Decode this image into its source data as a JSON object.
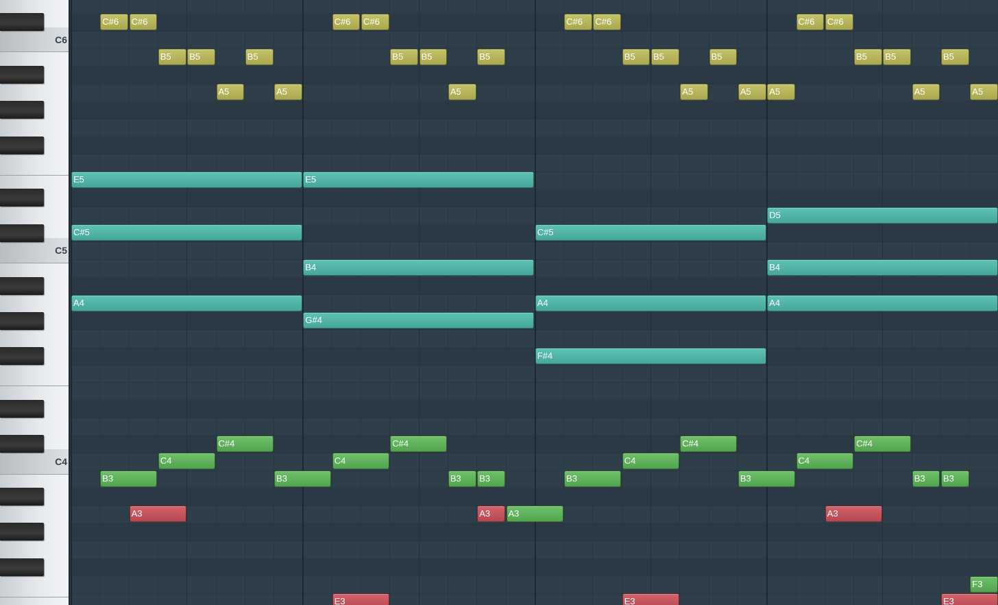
{
  "app": {
    "view": "piano-roll"
  },
  "keyboard": {
    "octave_labels": [
      "C6",
      "C5",
      "C4"
    ]
  },
  "note_colors": {
    "yellow": "#b9b85c",
    "teal": "#52b6a8",
    "green": "#62b35e",
    "red": "#c4545e"
  },
  "notes": [
    {
      "label": "C#6",
      "color": "yellow",
      "start": 1,
      "len": 1,
      "pitch": 85
    },
    {
      "label": "C#6",
      "color": "yellow",
      "start": 2,
      "len": 1,
      "pitch": 85
    },
    {
      "label": "C#6",
      "color": "yellow",
      "start": 9,
      "len": 1,
      "pitch": 85
    },
    {
      "label": "C#6",
      "color": "yellow",
      "start": 10,
      "len": 1,
      "pitch": 85
    },
    {
      "label": "C#6",
      "color": "yellow",
      "start": 17,
      "len": 1,
      "pitch": 85
    },
    {
      "label": "C#6",
      "color": "yellow",
      "start": 18,
      "len": 1,
      "pitch": 85
    },
    {
      "label": "C#6",
      "color": "yellow",
      "start": 25,
      "len": 1,
      "pitch": 85
    },
    {
      "label": "C#6",
      "color": "yellow",
      "start": 26,
      "len": 1,
      "pitch": 85
    },
    {
      "label": "B5",
      "color": "yellow",
      "start": 3,
      "len": 1,
      "pitch": 83
    },
    {
      "label": "B5",
      "color": "yellow",
      "start": 4,
      "len": 1,
      "pitch": 83
    },
    {
      "label": "B5",
      "color": "yellow",
      "start": 6,
      "len": 1,
      "pitch": 83
    },
    {
      "label": "B5",
      "color": "yellow",
      "start": 11,
      "len": 1,
      "pitch": 83
    },
    {
      "label": "B5",
      "color": "yellow",
      "start": 12,
      "len": 1,
      "pitch": 83
    },
    {
      "label": "B5",
      "color": "yellow",
      "start": 14,
      "len": 1,
      "pitch": 83
    },
    {
      "label": "B5",
      "color": "yellow",
      "start": 19,
      "len": 1,
      "pitch": 83
    },
    {
      "label": "B5",
      "color": "yellow",
      "start": 20,
      "len": 1,
      "pitch": 83
    },
    {
      "label": "B5",
      "color": "yellow",
      "start": 22,
      "len": 1,
      "pitch": 83
    },
    {
      "label": "B5",
      "color": "yellow",
      "start": 27,
      "len": 1,
      "pitch": 83
    },
    {
      "label": "B5",
      "color": "yellow",
      "start": 28,
      "len": 1,
      "pitch": 83
    },
    {
      "label": "B5",
      "color": "yellow",
      "start": 30,
      "len": 1,
      "pitch": 83
    },
    {
      "label": "A5",
      "color": "yellow",
      "start": 5,
      "len": 1,
      "pitch": 81
    },
    {
      "label": "A5",
      "color": "yellow",
      "start": 7,
      "len": 1,
      "pitch": 81
    },
    {
      "label": "A5",
      "color": "yellow",
      "start": 13,
      "len": 1,
      "pitch": 81
    },
    {
      "label": "A5",
      "color": "yellow",
      "start": 21,
      "len": 1,
      "pitch": 81
    },
    {
      "label": "A5",
      "color": "yellow",
      "start": 23,
      "len": 1,
      "pitch": 81
    },
    {
      "label": "A5",
      "color": "yellow",
      "start": 24,
      "len": 1,
      "pitch": 81
    },
    {
      "label": "A5",
      "color": "yellow",
      "start": 29,
      "len": 1,
      "pitch": 81
    },
    {
      "label": "A5",
      "color": "yellow",
      "start": 31,
      "len": 1,
      "pitch": 81
    },
    {
      "label": "E5",
      "color": "teal",
      "start": 0,
      "len": 8,
      "pitch": 76
    },
    {
      "label": "E5",
      "color": "teal",
      "start": 8,
      "len": 8,
      "pitch": 76
    },
    {
      "label": "D5",
      "color": "teal",
      "start": 24,
      "len": 8,
      "pitch": 74
    },
    {
      "label": "C#5",
      "color": "teal",
      "start": 0,
      "len": 8,
      "pitch": 73
    },
    {
      "label": "C#5",
      "color": "teal",
      "start": 16,
      "len": 8,
      "pitch": 73
    },
    {
      "label": "B4",
      "color": "teal",
      "start": 8,
      "len": 8,
      "pitch": 71
    },
    {
      "label": "B4",
      "color": "teal",
      "start": 24,
      "len": 8,
      "pitch": 71
    },
    {
      "label": "A4",
      "color": "teal",
      "start": 0,
      "len": 8,
      "pitch": 69
    },
    {
      "label": "A4",
      "color": "teal",
      "start": 16,
      "len": 8,
      "pitch": 69
    },
    {
      "label": "A4",
      "color": "teal",
      "start": 24,
      "len": 8,
      "pitch": 69
    },
    {
      "label": "G#4",
      "color": "teal",
      "start": 8,
      "len": 8,
      "pitch": 68
    },
    {
      "label": "F#4",
      "color": "teal",
      "start": 16,
      "len": 8,
      "pitch": 66
    },
    {
      "label": "C#4",
      "color": "green",
      "start": 5,
      "len": 2,
      "pitch": 61
    },
    {
      "label": "C#4",
      "color": "green",
      "start": 11,
      "len": 2,
      "pitch": 61
    },
    {
      "label": "C#4",
      "color": "green",
      "start": 21,
      "len": 2,
      "pitch": 61
    },
    {
      "label": "C#4",
      "color": "green",
      "start": 27,
      "len": 2,
      "pitch": 61
    },
    {
      "label": "C4",
      "color": "green",
      "start": 3,
      "len": 2,
      "pitch": 60
    },
    {
      "label": "C4",
      "color": "green",
      "start": 9,
      "len": 2,
      "pitch": 60
    },
    {
      "label": "C4",
      "color": "green",
      "start": 19,
      "len": 2,
      "pitch": 60
    },
    {
      "label": "C4",
      "color": "green",
      "start": 25,
      "len": 2,
      "pitch": 60
    },
    {
      "label": "B3",
      "color": "green",
      "start": 1,
      "len": 2,
      "pitch": 59
    },
    {
      "label": "B3",
      "color": "green",
      "start": 7,
      "len": 2,
      "pitch": 59
    },
    {
      "label": "B3",
      "color": "green",
      "start": 13,
      "len": 1,
      "pitch": 59
    },
    {
      "label": "B3",
      "color": "green",
      "start": 14,
      "len": 1,
      "pitch": 59
    },
    {
      "label": "B3",
      "color": "green",
      "start": 17,
      "len": 2,
      "pitch": 59
    },
    {
      "label": "B3",
      "color": "green",
      "start": 23,
      "len": 2,
      "pitch": 59
    },
    {
      "label": "B3",
      "color": "green",
      "start": 29,
      "len": 1,
      "pitch": 59
    },
    {
      "label": "B3",
      "color": "green",
      "start": 30,
      "len": 1,
      "pitch": 59
    },
    {
      "label": "A3",
      "color": "red",
      "start": 2,
      "len": 2,
      "pitch": 57
    },
    {
      "label": "A3",
      "color": "red",
      "start": 14,
      "len": 1,
      "pitch": 57
    },
    {
      "label": "A3",
      "color": "green",
      "start": 15,
      "len": 2,
      "pitch": 57
    },
    {
      "label": "A3",
      "color": "red",
      "start": 26,
      "len": 2,
      "pitch": 57
    },
    {
      "label": "F3",
      "color": "green",
      "start": 31,
      "len": 1,
      "pitch": 53
    },
    {
      "label": "E3",
      "color": "red",
      "start": 9,
      "len": 2,
      "pitch": 52
    },
    {
      "label": "E3",
      "color": "red",
      "start": 19,
      "len": 2,
      "pitch": 52
    },
    {
      "label": "E3",
      "color": "red",
      "start": 30,
      "len": 2,
      "pitch": 52
    }
  ]
}
